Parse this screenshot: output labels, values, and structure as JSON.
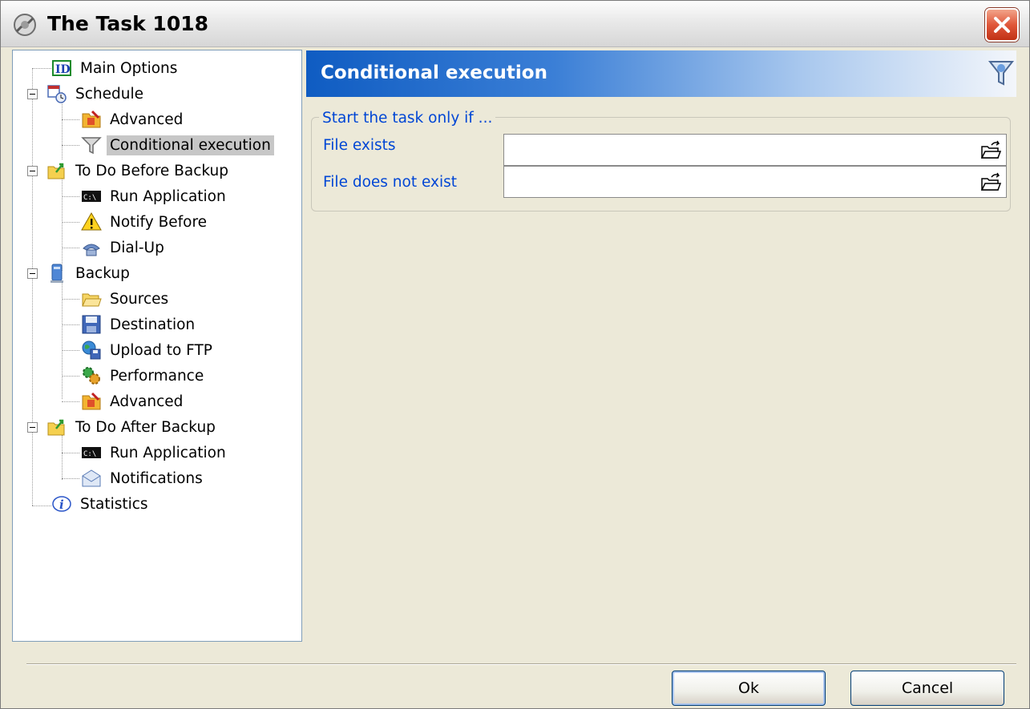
{
  "window": {
    "title": "The Task 1018",
    "close_icon": "close-icon"
  },
  "tree": {
    "items": [
      {
        "label": "Main Options",
        "icon": "id-icon"
      },
      {
        "label": "Schedule",
        "icon": "calendar-clock-icon"
      },
      {
        "label": "Advanced",
        "icon": "advanced-settings-icon"
      },
      {
        "label": "Conditional execution",
        "icon": "filter-icon",
        "selected": true
      },
      {
        "label": "To Do Before Backup",
        "icon": "folder-arrow-icon"
      },
      {
        "label": "Run Application",
        "icon": "console-icon"
      },
      {
        "label": "Notify Before",
        "icon": "warning-icon"
      },
      {
        "label": "Dial-Up",
        "icon": "phone-icon"
      },
      {
        "label": "Backup",
        "icon": "computer-icon"
      },
      {
        "label": "Sources",
        "icon": "folder-icon"
      },
      {
        "label": "Destination",
        "icon": "floppy-icon"
      },
      {
        "label": "Upload to FTP",
        "icon": "globe-floppy-icon"
      },
      {
        "label": "Performance",
        "icon": "gears-icon"
      },
      {
        "label": "Advanced",
        "icon": "advanced-settings-icon"
      },
      {
        "label": "To Do After Backup",
        "icon": "folder-arrow-icon"
      },
      {
        "label": "Run Application",
        "icon": "console-icon"
      },
      {
        "label": "Notifications",
        "icon": "envelope-icon"
      },
      {
        "label": "Statistics",
        "icon": "info-icon"
      }
    ]
  },
  "panel": {
    "title": "Conditional execution",
    "group_label": "Start the task only if ...",
    "fields": [
      {
        "label": "File exists",
        "value": ""
      },
      {
        "label": "File does not exist",
        "value": ""
      }
    ]
  },
  "footer": {
    "ok_label": "Ok",
    "cancel_label": "Cancel"
  }
}
